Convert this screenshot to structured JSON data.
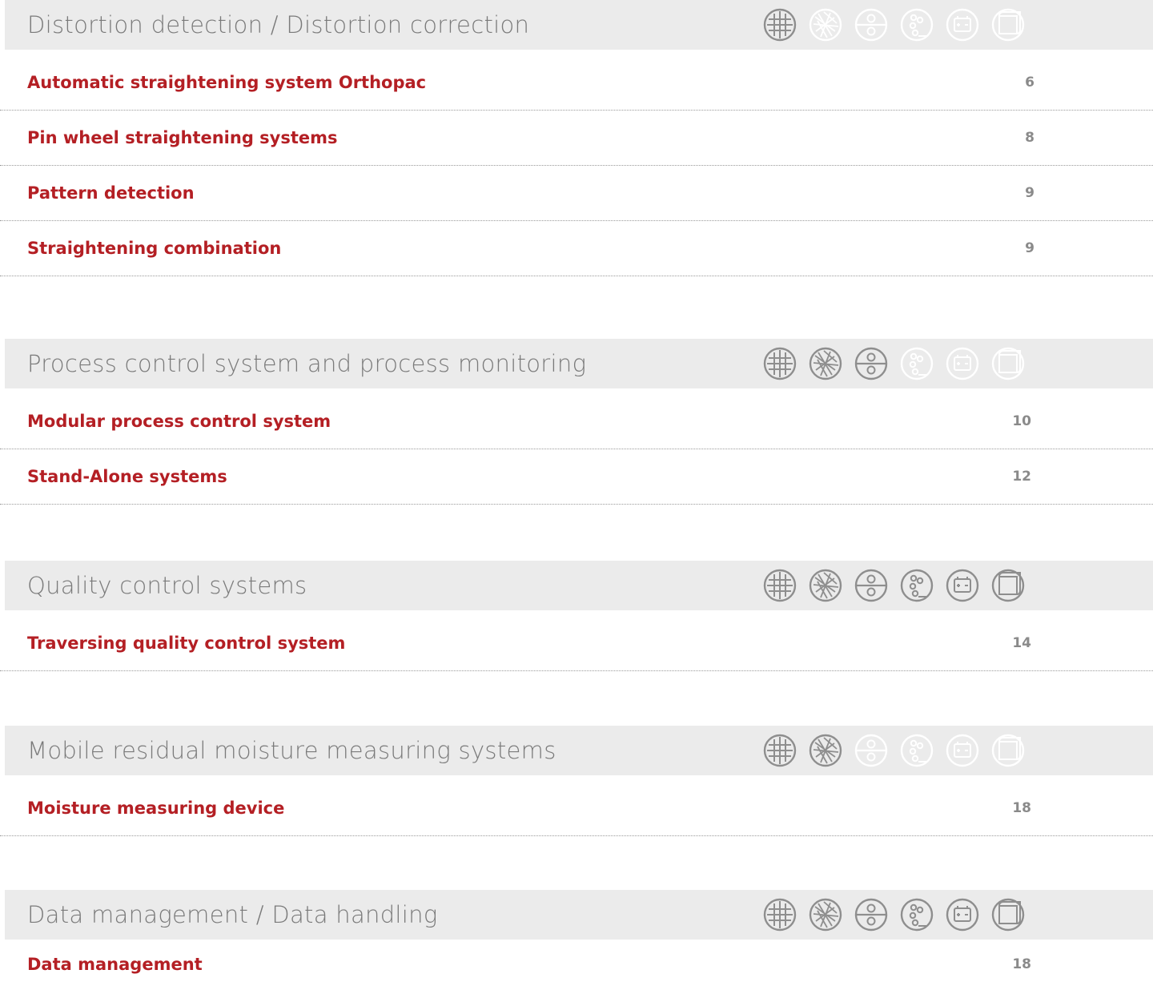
{
  "sections": [
    {
      "title": "Distortion detection / Distortion correction",
      "icons": [
        {
          "name": "grid-icon",
          "active": true
        },
        {
          "name": "fibre-icon",
          "active": false
        },
        {
          "name": "roll-icon",
          "active": false
        },
        {
          "name": "dots-icon",
          "active": false
        },
        {
          "name": "battery-icon",
          "active": false
        },
        {
          "name": "sheet-icon",
          "active": false
        }
      ],
      "rows": [
        {
          "label": "Automatic straightening system Orthopac",
          "page": "6"
        },
        {
          "label": "Pin wheel straightening systems",
          "page": "8"
        },
        {
          "label": "Pattern detection",
          "page": "9"
        },
        {
          "label": "Straightening combination",
          "page": "9"
        }
      ]
    },
    {
      "title": "Process control system and process monitoring",
      "icons": [
        {
          "name": "grid-icon",
          "active": true
        },
        {
          "name": "fibre-icon",
          "active": true
        },
        {
          "name": "roll-icon",
          "active": true
        },
        {
          "name": "dots-icon",
          "active": false
        },
        {
          "name": "battery-icon",
          "active": false
        },
        {
          "name": "sheet-icon",
          "active": false
        }
      ],
      "rows": [
        {
          "label": "Modular process control system",
          "page": "10"
        },
        {
          "label": "Stand-Alone systems",
          "page": "12"
        }
      ]
    },
    {
      "title": "Quality control systems",
      "icons": [
        {
          "name": "grid-icon",
          "active": true
        },
        {
          "name": "fibre-icon",
          "active": true
        },
        {
          "name": "roll-icon",
          "active": true
        },
        {
          "name": "dots-icon",
          "active": true
        },
        {
          "name": "battery-icon",
          "active": true
        },
        {
          "name": "sheet-icon",
          "active": true
        }
      ],
      "rows": [
        {
          "label": "Traversing quality control system",
          "page": "14"
        }
      ]
    },
    {
      "title": "Mobile residual moisture measuring systems",
      "icons": [
        {
          "name": "grid-icon",
          "active": true
        },
        {
          "name": "fibre-icon",
          "active": true
        },
        {
          "name": "roll-icon",
          "active": false
        },
        {
          "name": "dots-icon",
          "active": false
        },
        {
          "name": "battery-icon",
          "active": false
        },
        {
          "name": "sheet-icon",
          "active": false
        }
      ],
      "rows": [
        {
          "label": "Moisture measuring device",
          "page": "18"
        }
      ]
    },
    {
      "title": "Data management / Data handling",
      "icons": [
        {
          "name": "grid-icon",
          "active": true
        },
        {
          "name": "fibre-icon",
          "active": true
        },
        {
          "name": "roll-icon",
          "active": true
        },
        {
          "name": "dots-icon",
          "active": true
        },
        {
          "name": "battery-icon",
          "active": true
        },
        {
          "name": "sheet-icon",
          "active": true
        }
      ],
      "rows": [
        {
          "label": "Data management",
          "page": "18"
        }
      ]
    }
  ]
}
